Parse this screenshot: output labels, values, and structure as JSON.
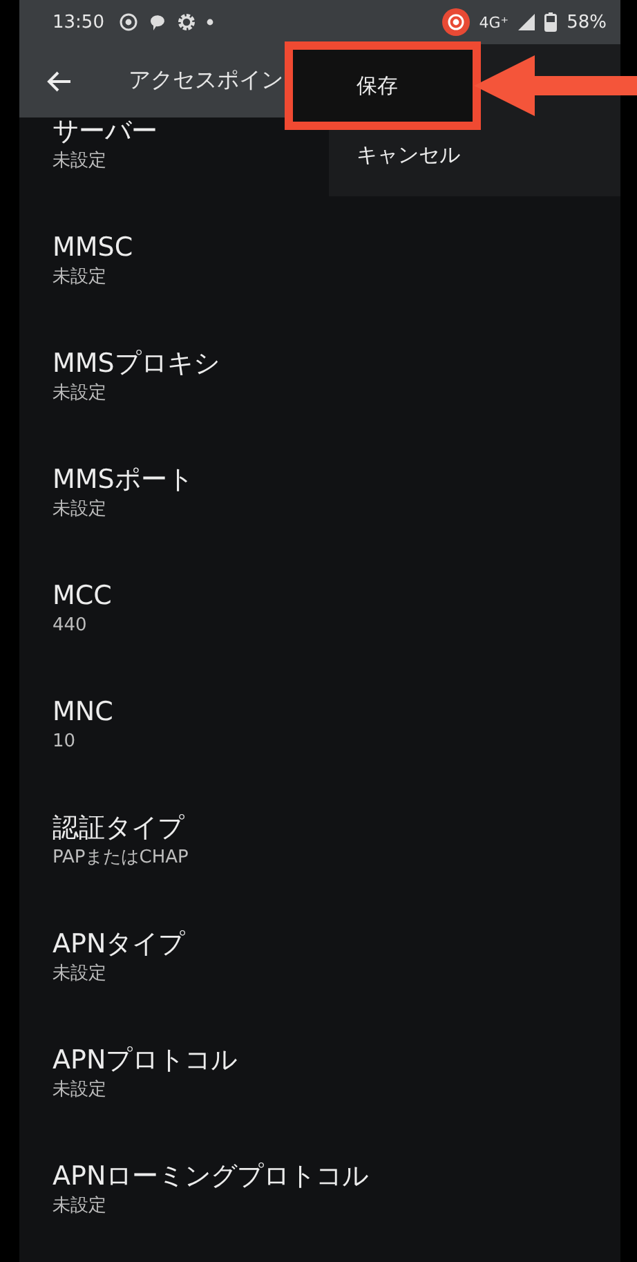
{
  "status_bar": {
    "time": "13:50",
    "network": "4G⁺",
    "battery": "58%"
  },
  "app_bar": {
    "title": "アクセスポイン"
  },
  "menu": [
    {
      "label": "保存",
      "highlighted": true
    },
    {
      "label": "キャンセル",
      "highlighted": false
    }
  ],
  "settings": [
    {
      "title": "サーバー",
      "value": "未設定"
    },
    {
      "title": "MMSC",
      "value": "未設定"
    },
    {
      "title": "MMSプロキシ",
      "value": "未設定"
    },
    {
      "title": "MMSポート",
      "value": "未設定"
    },
    {
      "title": "MCC",
      "value": "440"
    },
    {
      "title": "MNC",
      "value": "10"
    },
    {
      "title": "認証タイプ",
      "value": "PAPまたはCHAP"
    },
    {
      "title": "APNタイプ",
      "value": "未設定"
    },
    {
      "title": "APNプロトコル",
      "value": "未設定"
    },
    {
      "title": "APNローミングプロトコル",
      "value": "未設定"
    }
  ]
}
